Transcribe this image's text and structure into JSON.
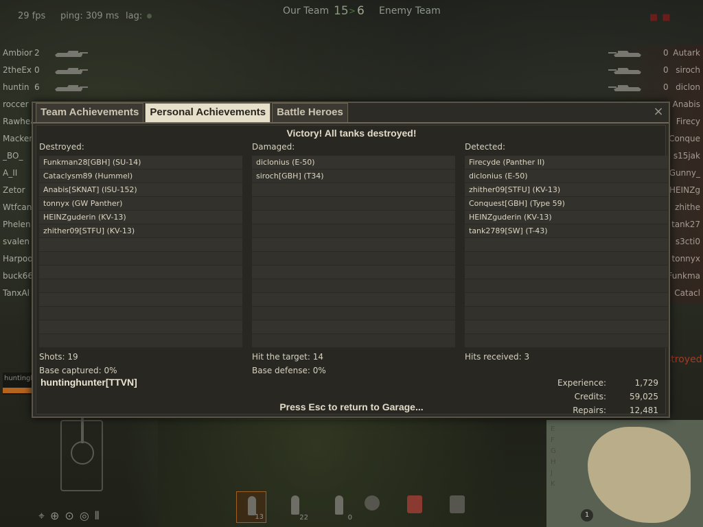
{
  "hud": {
    "fps": "29 fps",
    "ping": "ping: 309 ms",
    "lag": "lag:",
    "our_team": "Our Team",
    "score_our": "15",
    "score_enemy": "6",
    "enemy_team": "Enemy Team",
    "destroyed_banner": "stroyed!",
    "player_tag": "huntinghu"
  },
  "left_team": [
    {
      "name": "Ambior",
      "frags": "2"
    },
    {
      "name": "2theEx",
      "frags": "0"
    },
    {
      "name": "huntin",
      "frags": "6"
    },
    {
      "name": "roccer",
      "frags": ""
    },
    {
      "name": "Rawhea",
      "frags": ""
    },
    {
      "name": "Macker",
      "frags": ""
    },
    {
      "name": "_BO_",
      "frags": ""
    },
    {
      "name": "A_II",
      "frags": ""
    },
    {
      "name": "Zetor",
      "frags": ""
    },
    {
      "name": "Wtfcan",
      "frags": ""
    },
    {
      "name": "Phelen",
      "frags": ""
    },
    {
      "name": "svalen",
      "frags": ""
    },
    {
      "name": "Harpoo",
      "frags": ""
    },
    {
      "name": "buck66",
      "frags": ""
    },
    {
      "name": "TanxAl",
      "frags": ""
    }
  ],
  "right_team": [
    {
      "name": "Autark",
      "frags": "0"
    },
    {
      "name": "siroch",
      "frags": "0"
    },
    {
      "name": "diclon",
      "frags": "0"
    },
    {
      "name": "Anabis",
      "frags": ""
    },
    {
      "name": "Firecy",
      "frags": ""
    },
    {
      "name": "Conque",
      "frags": ""
    },
    {
      "name": "s15jak",
      "frags": ""
    },
    {
      "name": "Gunny_",
      "frags": ""
    },
    {
      "name": "HEINZg",
      "frags": ""
    },
    {
      "name": "zhithe",
      "frags": ""
    },
    {
      "name": "tank27",
      "frags": ""
    },
    {
      "name": "s3cti0",
      "frags": ""
    },
    {
      "name": "tonnyx",
      "frags": ""
    },
    {
      "name": "Funkma",
      "frags": ""
    },
    {
      "name": "Catacl",
      "frags": ""
    }
  ],
  "ammo": [
    {
      "count": "13",
      "selected": true
    },
    {
      "count": "22",
      "selected": false
    },
    {
      "count": "0",
      "selected": false
    }
  ],
  "dialog": {
    "tabs": [
      "Team Achievements",
      "Personal Achievements",
      "Battle Heroes"
    ],
    "active_tab": "Personal Achievements",
    "close": "×",
    "headline": "Victory! All tanks destroyed!",
    "destroyed": {
      "label": "Destroyed:",
      "items": [
        "Funkman28[GBH] (SU-14)",
        "Cataclysm89 (Hummel)",
        "Anabis[SKNAT] (ISU-152)",
        "tonnyx (GW Panther)",
        "HEINZguderin (KV-13)",
        "zhither09[STFU] (KV-13)"
      ]
    },
    "damaged": {
      "label": "Damaged:",
      "items": [
        "diclonius (E-50)",
        "siroch[GBH] (T34)"
      ]
    },
    "detected": {
      "label": "Detected:",
      "items": [
        "Firecyde (Panther II)",
        "diclonius (E-50)",
        "zhither09[STFU] (KV-13)",
        "Conquest[GBH] (Type 59)",
        "HEINZguderin (KV-13)",
        "tank2789[SW] (T-43)"
      ]
    },
    "stats": {
      "shots": "Shots: 19",
      "hit_target": "Hit the target: 14",
      "hits_received": "Hits received: 3",
      "base_captured": "Base captured: 0%",
      "base_defense": "Base defense: 0%"
    },
    "player": "huntinghunter[TTVN]",
    "earnings": [
      {
        "label": "Experience:",
        "value": "1,729"
      },
      {
        "label": "Credits:",
        "value": "59,025"
      },
      {
        "label": "Repairs:",
        "value": "12,481"
      }
    ],
    "esc_message": "Press Esc to return to Garage..."
  }
}
